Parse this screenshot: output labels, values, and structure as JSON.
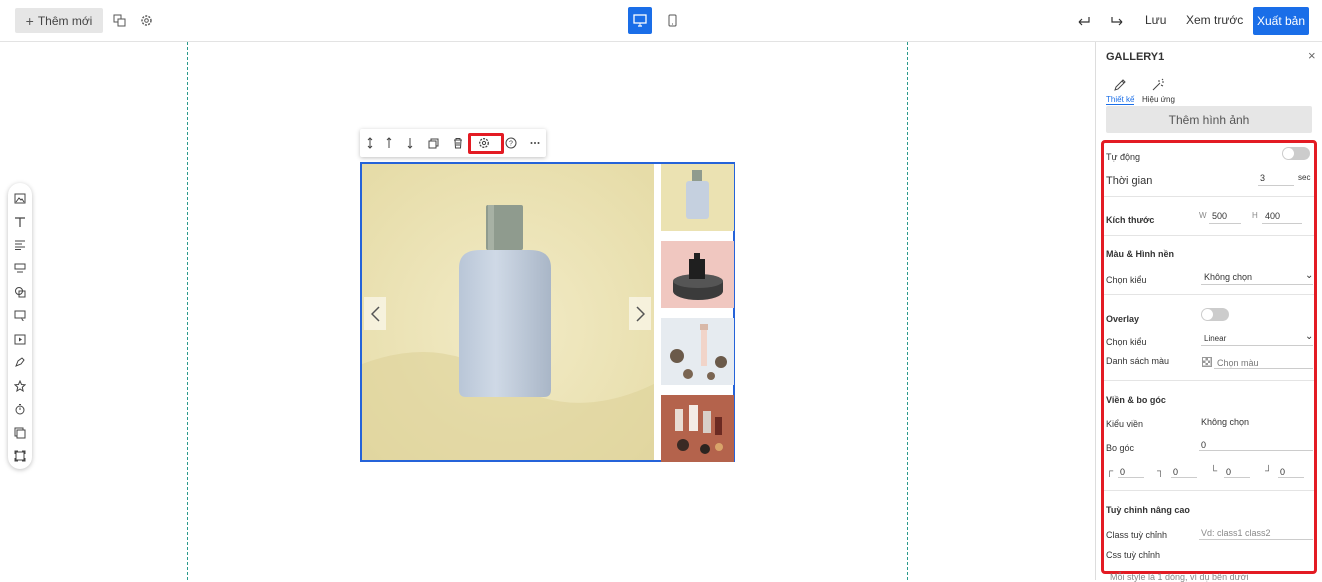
{
  "topbar": {
    "new_label": "Thêm mới",
    "save_label": "Lưu",
    "preview_label": "Xem trước",
    "publish_label": "Xuất bản",
    "accent": "#1a6ee8"
  },
  "panel": {
    "title": "GALLERY1",
    "close": "×",
    "tabs": [
      {
        "label": "Thiết kế",
        "icon": "edit-icon",
        "active": true
      },
      {
        "label": "Hiệu ứng",
        "icon": "magic-wand-icon",
        "active": false
      }
    ],
    "add_image_label": "Thêm hình ảnh",
    "auto": {
      "label": "Tự động",
      "on": false
    },
    "duration": {
      "label": "Thời gian",
      "value": "3",
      "unit": "sec"
    },
    "size": {
      "label": "Kích thước",
      "w_label": "W",
      "w_value": "500",
      "h_label": "H",
      "h_value": "400"
    },
    "bg": {
      "section": "Màu & Hình nền",
      "style_label": "Chọn kiểu",
      "style_value": "Không chọn"
    },
    "overlay": {
      "section": "Overlay",
      "on": false,
      "style_label": "Chọn kiểu",
      "style_value": "Linear",
      "colors_label": "Danh sách màu",
      "colors_value": "Chọn màu"
    },
    "border": {
      "section": "Viền & bo góc",
      "style_label": "Kiểu viền",
      "style_value": "Không chọn",
      "radius_label": "Bo góc",
      "radius_value": "0",
      "corners": [
        "0",
        "0",
        "0",
        "0"
      ]
    },
    "advanced": {
      "section": "Tuỳ chỉnh nâng cao",
      "class_label": "Class tuỳ chỉnh",
      "class_placeholder": "Vd: class1 class2",
      "css_label": "Css tuỳ chỉnh"
    },
    "footer_hint": "Mỗi style là 1 dòng, ví dụ bên dưới"
  },
  "colors": {
    "selection": "#2563d9",
    "highlight": "#e31b23",
    "guide": "#2a9a8c"
  }
}
